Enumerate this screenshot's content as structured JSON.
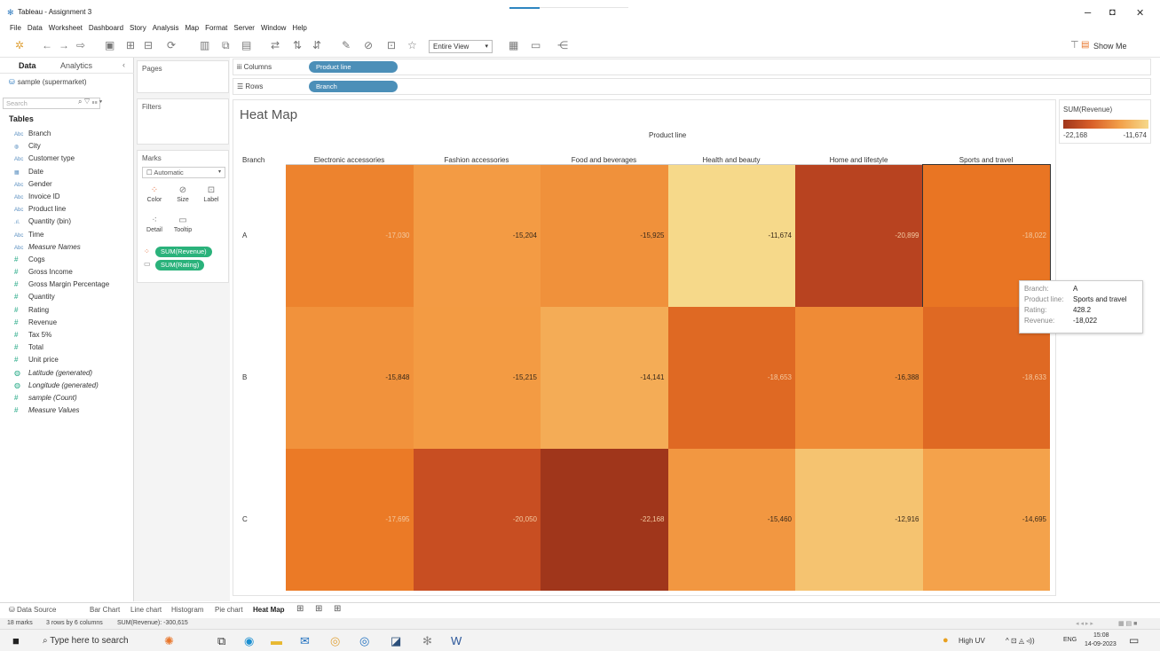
{
  "window": {
    "title": "Tableau - Assignment 3",
    "min": "–",
    "max": "◘",
    "close": "✕"
  },
  "menu": [
    "File",
    "Data",
    "Worksheet",
    "Dashboard",
    "Story",
    "Analysis",
    "Map",
    "Format",
    "Server",
    "Window",
    "Help"
  ],
  "toolbar": {
    "fit": "Entire View",
    "show_me": "Show Me"
  },
  "data_pane": {
    "tab_data": "Data",
    "tab_analytics": "Analytics",
    "source": "sample (supermarket)",
    "search_placeholder": "Search",
    "tables_label": "Tables",
    "fields": [
      {
        "icon": "Abc",
        "name": "Branch",
        "measure": false,
        "italic": false
      },
      {
        "icon": "◍",
        "name": "City",
        "measure": false,
        "italic": false
      },
      {
        "icon": "Abc",
        "name": "Customer type",
        "measure": false,
        "italic": false
      },
      {
        "icon": "▦",
        "name": "Date",
        "measure": false,
        "italic": false
      },
      {
        "icon": "Abc",
        "name": "Gender",
        "measure": false,
        "italic": false
      },
      {
        "icon": "Abc",
        "name": "Invoice ID",
        "measure": false,
        "italic": false
      },
      {
        "icon": "Abc",
        "name": "Product line",
        "measure": false,
        "italic": false
      },
      {
        "icon": ".ıl.",
        "name": "Quantity (bin)",
        "measure": false,
        "italic": false
      },
      {
        "icon": "Abc",
        "name": "Time",
        "measure": false,
        "italic": false
      },
      {
        "icon": "Abc",
        "name": "Measure Names",
        "measure": false,
        "italic": true
      },
      {
        "icon": "#",
        "name": "Cogs",
        "measure": true,
        "italic": false
      },
      {
        "icon": "#",
        "name": "Gross Income",
        "measure": true,
        "italic": false
      },
      {
        "icon": "#",
        "name": "Gross Margin Percentage",
        "measure": true,
        "italic": false
      },
      {
        "icon": "#",
        "name": "Quantity",
        "measure": true,
        "italic": false
      },
      {
        "icon": "#",
        "name": "Rating",
        "measure": true,
        "italic": false
      },
      {
        "icon": "#",
        "name": "Revenue",
        "measure": true,
        "italic": false
      },
      {
        "icon": "#",
        "name": "Tax 5%",
        "measure": true,
        "italic": false
      },
      {
        "icon": "#",
        "name": "Total",
        "measure": true,
        "italic": false
      },
      {
        "icon": "#",
        "name": "Unit price",
        "measure": true,
        "italic": false
      },
      {
        "icon": "◍",
        "name": "Latitude (generated)",
        "measure": true,
        "italic": true
      },
      {
        "icon": "◍",
        "name": "Longitude (generated)",
        "measure": true,
        "italic": true
      },
      {
        "icon": "#",
        "name": "sample (Count)",
        "measure": true,
        "italic": true
      },
      {
        "icon": "#",
        "name": "Measure Values",
        "measure": true,
        "italic": true
      }
    ]
  },
  "cards": {
    "pages": "Pages",
    "filters": "Filters",
    "marks": "Marks",
    "mark_type": "Automatic",
    "color": "Color",
    "size": "Size",
    "label": "Label",
    "detail": "Detail",
    "tooltip": "Tooltip",
    "pill_color": "SUM(Revenue)",
    "pill_tooltip": "SUM(Rating)"
  },
  "shelves": {
    "columns_label": "Columns",
    "columns_pill": "Product line",
    "rows_label": "Rows",
    "rows_pill": "Branch"
  },
  "view": {
    "title": "Heat Map",
    "column_axis_title": "Product line",
    "row_header": "Branch"
  },
  "chart_data": {
    "type": "heatmap",
    "title": "Heat Map",
    "x_field": "Product line",
    "y_field": "Branch",
    "color_field": "SUM(Revenue)",
    "columns": [
      "Electronic accessories",
      "Fashion accessories",
      "Food and beverages",
      "Health and beauty",
      "Home and lifestyle",
      "Sports and travel"
    ],
    "rows": [
      "A",
      "B",
      "C"
    ],
    "values": [
      [
        -17030,
        -15204,
        -15925,
        -11674,
        -20899,
        -18022
      ],
      [
        -15848,
        -15215,
        -14141,
        -18653,
        -16388,
        -18633
      ],
      [
        -17695,
        -20050,
        -22168,
        -15460,
        -12916,
        -14695
      ]
    ],
    "labels": [
      [
        "-17,030",
        "-15,204",
        "-15,925",
        "-11,674",
        "-20,899",
        "-18,022"
      ],
      [
        "-15,848",
        "-15,215",
        "-14,141",
        "-18,653",
        "-16,388",
        "-18,633"
      ],
      [
        "-17,695",
        "-20,050",
        "-22,168",
        "-15,460",
        "-12,916",
        "-14,695"
      ]
    ],
    "color_range": [
      -22168,
      -11674
    ],
    "colors": {
      "dark": "#a0361b",
      "mid": "#ea7623",
      "light": "#f6d98a"
    }
  },
  "legend": {
    "title": "SUM(Revenue)",
    "min_label": "-22,168",
    "max_label": "-11,674"
  },
  "tooltip": {
    "rows": [
      {
        "k": "Branch:",
        "v": "A"
      },
      {
        "k": "Product line:",
        "v": "Sports and travel"
      },
      {
        "k": "Rating:",
        "v": "428.2"
      },
      {
        "k": "Revenue:",
        "v": "-18,022"
      }
    ]
  },
  "sheet_tabs": {
    "data_source": "Data Source",
    "tabs": [
      "Bar Chart",
      "Line chart",
      "Histogram",
      "Pie chart",
      "Heat Map"
    ],
    "active": "Heat Map"
  },
  "status": {
    "marks": "18 marks",
    "dims": "3 rows by 6 columns",
    "sum": "SUM(Revenue): -300,615"
  },
  "taskbar": {
    "search": "Type here to search",
    "weather": "High UV",
    "lang": "ENG",
    "time": "15:08",
    "date": "14-09-2023"
  }
}
